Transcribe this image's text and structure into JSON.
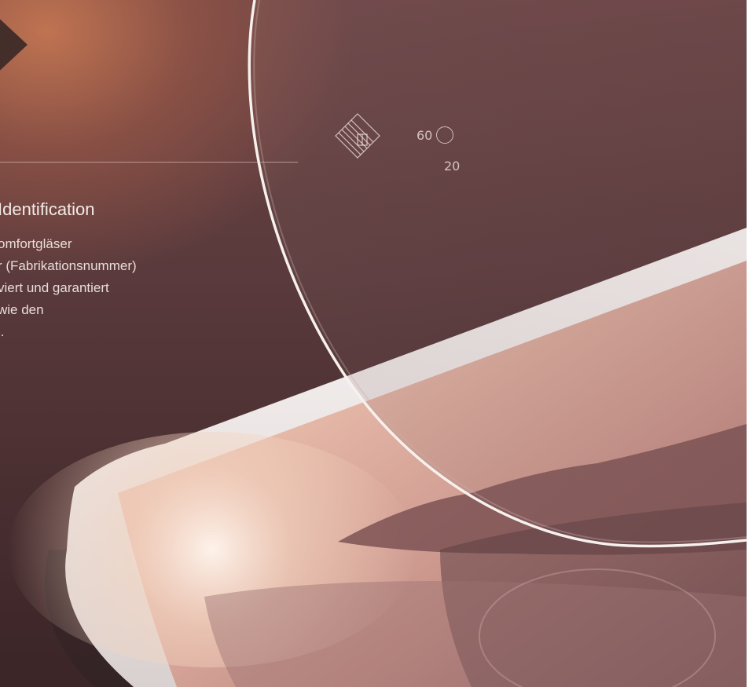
{
  "navigation": {
    "arrow_icon": "chevron-right-icon"
  },
  "text_panel": {
    "heading": "Identification",
    "body_lines": [
      "omfortgläser",
      "r (Fabrikationsnummer)",
      "viert und garantiert",
      "wie den",
      "l."
    ]
  },
  "lens_engraving": {
    "logo_icon": "diamond-logo-icon",
    "index_value": "60",
    "circle_marker_icon": "circle-icon",
    "addition_value": "20"
  },
  "colors": {
    "background_dark": "#4a2f31",
    "background_warm": "#c47652",
    "text_light": "#f3ebe8",
    "lens_outline": "#f7f1ee",
    "tablet_frame": "#f3efee"
  }
}
